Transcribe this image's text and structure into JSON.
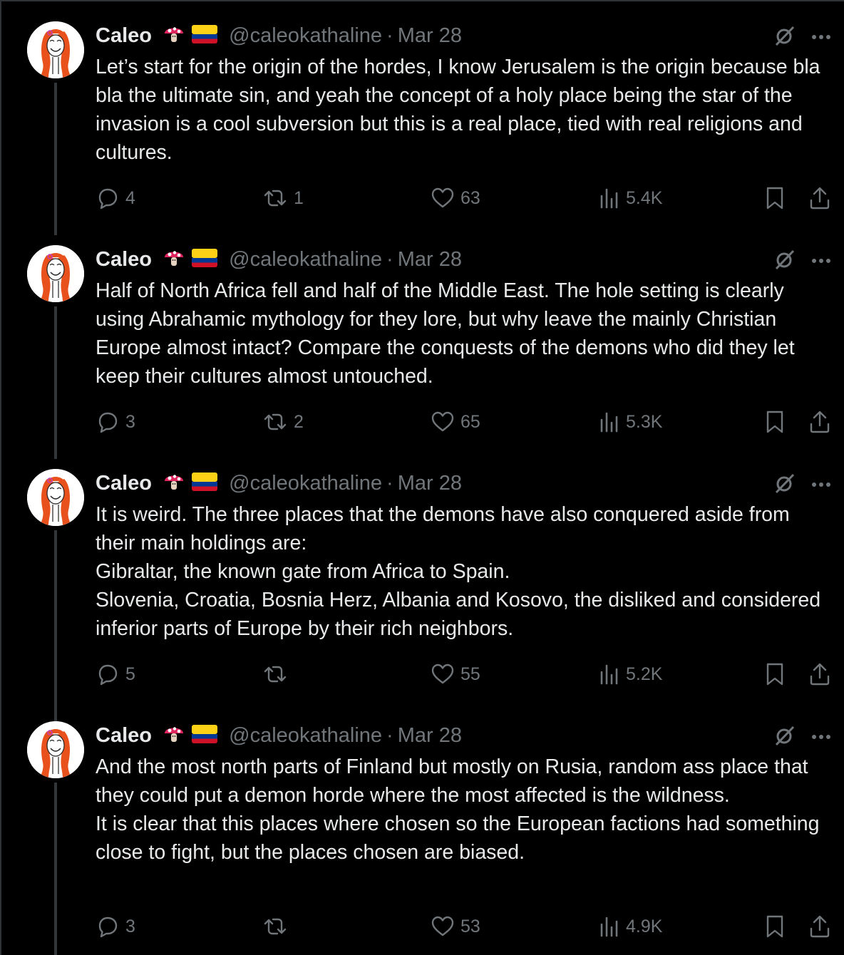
{
  "colors": {
    "background": "#000000",
    "text": "#e7e9ea",
    "muted": "#71767b",
    "thread_line": "#333639"
  },
  "tweets": [
    {
      "name": "Caleo",
      "badges": [
        "mushroom-emoji",
        "colombia-flag-emoji"
      ],
      "handle": "@caleokathaline",
      "dot": "·",
      "date": "Mar 28",
      "text": "Let’s start for the origin of the hordes, I know Jerusalem is the origin because bla bla the ultimate sin, and yeah the concept of a holy place being the star of the invasion is a cool subversion but this is a real place, tied with real religions and cultures.",
      "replies": "4",
      "reposts": "1",
      "likes": "63",
      "views": "5.4K"
    },
    {
      "name": "Caleo",
      "badges": [
        "mushroom-emoji",
        "colombia-flag-emoji"
      ],
      "handle": "@caleokathaline",
      "dot": "·",
      "date": "Mar 28",
      "text": "Half of North Africa fell and half of the Middle East. The hole setting is clearly using Abrahamic mythology for they lore, but why leave the mainly Christian Europe almost intact? Compare the conquests of the demons who did they let keep their cultures almost untouched.",
      "replies": "3",
      "reposts": "2",
      "likes": "65",
      "views": "5.3K"
    },
    {
      "name": "Caleo",
      "badges": [
        "mushroom-emoji",
        "colombia-flag-emoji"
      ],
      "handle": "@caleokathaline",
      "dot": "·",
      "date": "Mar 28",
      "text": "It is weird. The three places that the demons have also conquered aside from their main holdings are:\nGibraltar, the known gate from Africa to Spain.\nSlovenia, Croatia, Bosnia Herz, Albania and Kosovo, the disliked and considered inferior parts of Europe by their rich neighbors.",
      "replies": "5",
      "reposts": "",
      "likes": "55",
      "views": "5.2K"
    },
    {
      "name": "Caleo",
      "badges": [
        "mushroom-emoji",
        "colombia-flag-emoji"
      ],
      "handle": "@caleokathaline",
      "dot": "·",
      "date": "Mar 28",
      "text": "And the most north parts of Finland but mostly on Rusia, random ass place that they could put a demon horde where the most affected is the wildness.\nIt is clear that this places where chosen so the European factions had something close to fight, but the places chosen are biased.",
      "replies": "3",
      "reposts": "",
      "likes": "53",
      "views": "4.9K"
    }
  ]
}
